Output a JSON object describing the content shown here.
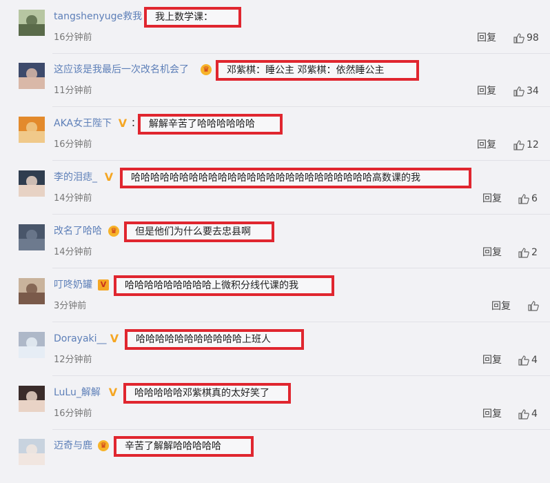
{
  "labels": {
    "reply": "回复"
  },
  "comments": [
    {
      "username": "tangshenyuge救我",
      "badge": "",
      "colon": "",
      "text": "我上数学课：",
      "time": "16分钟前",
      "likes": "98",
      "avatar_colors": [
        "#b7c6a2",
        "#5a6b4a"
      ]
    },
    {
      "username": "这应该是我最后一次改名机会了",
      "badge": "crown",
      "colon": "",
      "text": "邓紫棋：睡公主 邓紫棋：依然睡公主",
      "time": "11分钟前",
      "likes": "34",
      "avatar_colors": [
        "#3d4a6b",
        "#d9b8a8"
      ]
    },
    {
      "username": "AKA女王陛下",
      "badge": "v",
      "colon": "：",
      "text": "解解辛苦了哈哈哈哈哈哈",
      "time": "16分钟前",
      "likes": "12",
      "avatar_colors": [
        "#e38a2c",
        "#f0c98a"
      ]
    },
    {
      "username": "李的泪痣_",
      "badge": "v",
      "colon": "",
      "text": "哈哈哈哈哈哈哈哈哈哈哈哈哈哈哈哈哈哈哈哈哈哈哈哈哈高数课的我",
      "time": "14分钟前",
      "likes": "6",
      "avatar_colors": [
        "#2f3d4f",
        "#e7d2c4"
      ]
    },
    {
      "username": "改名了哈哈",
      "badge": "crown",
      "colon": "",
      "text": "但是他们为什么要去忠县啊",
      "time": "14分钟前",
      "likes": "2",
      "avatar_colors": [
        "#49566a",
        "#6d7a8e"
      ]
    },
    {
      "username": "叮咚奶罐",
      "badge": "vbox",
      "colon": "",
      "text": "哈哈哈哈哈哈哈哈哈上微积分线代课的我",
      "time": "3分钟前",
      "likes": "",
      "avatar_colors": [
        "#c9b39c",
        "#7a5a4a"
      ]
    },
    {
      "username": "Dorayaki__",
      "badge": "v",
      "colon": "",
      "text": "哈哈哈哈哈哈哈哈哈哈哈上班人",
      "time": "12分钟前",
      "likes": "4",
      "avatar_colors": [
        "#aeb8c8",
        "#e6edf5"
      ]
    },
    {
      "username": "LuLu_解解",
      "badge": "v",
      "colon": "",
      "text": "哈哈哈哈哈邓紫棋真的太好笑了",
      "time": "16分钟前",
      "likes": "4",
      "avatar_colors": [
        "#3a2c2a",
        "#e9d3c6"
      ]
    },
    {
      "username": "迈奇与鹿",
      "badge": "crown",
      "colon": "",
      "text": "辛苦了解解哈哈哈哈哈",
      "time": "",
      "likes": "",
      "avatar_colors": [
        "#c8d3df",
        "#f1e6e0"
      ]
    }
  ]
}
